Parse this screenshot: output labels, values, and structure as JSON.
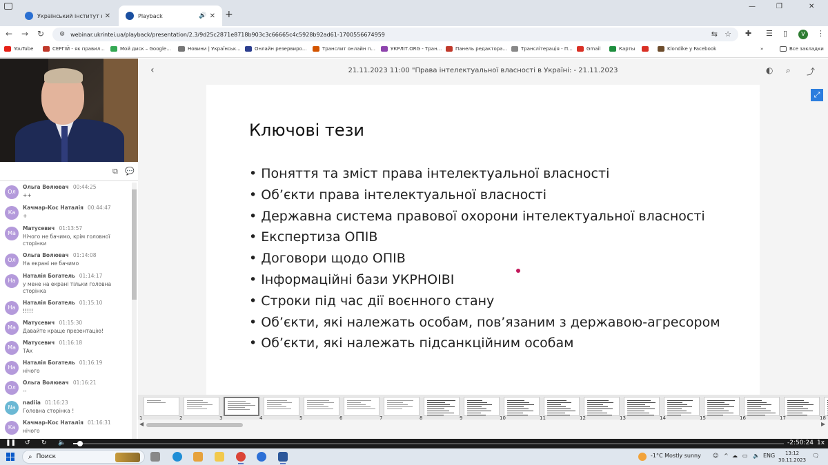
{
  "browser": {
    "tabs": [
      {
        "label": "Український інститут науково",
        "active": false
      },
      {
        "label": "Playback",
        "active": true
      }
    ],
    "url": "webinar.ukrintei.ua/playback/presentation/2.3/9d25c2871e8718b903c3c66665c4c5928b92ad61-1700556674959",
    "avatar_letter": "V",
    "bookmarks": [
      "YouTube",
      "СЕРГІЙ - як правил...",
      "Мой диск – Google...",
      "Новини | Українськ...",
      "Онлайн резервиро...",
      "Транслит онлайн п...",
      "УКРЛІТ.ORG - Тран...",
      "Панель редактора...",
      "Транслітерація - П...",
      "Gmail",
      "Карты",
      "",
      "Klondike у Facebook"
    ],
    "all_bookmarks": "Все закладки"
  },
  "presentation": {
    "title": "21.11.2023 11:00 \"Права інтелектуальної власності в Україні: - 21.11.2023",
    "slide_title": "Ключові тези",
    "bullets": [
      "Поняття та зміст права інтелектуальної власності",
      "Об’єкти права інтелектуальної власності",
      "Державна система правової охорони інтелектуальної власності",
      "Експертиза ОПІВ",
      "Договори щодо ОПІВ",
      "Інформаційні бази УКРНОІВІ",
      "Строки під час дії воєнного стану",
      "Об’єкти, які належать особам, пов’язаним з державою-агресором",
      "Об’єкти, які належать підсанкційним особам"
    ],
    "thumbnails": [
      "1",
      "2",
      "3",
      "4",
      "5",
      "6",
      "7",
      "8",
      "9",
      "10",
      "11",
      "12",
      "13",
      "14",
      "15",
      "16",
      "17",
      "18"
    ],
    "selected_thumbnail": 3
  },
  "chat": {
    "messages": [
      {
        "initials": "Ол",
        "name": "Ольга Волювач",
        "time": "00:44:25",
        "text": "++"
      },
      {
        "initials": "Ка",
        "name": "Качмар-Кос Наталія",
        "time": "00:44:47",
        "text": "+"
      },
      {
        "initials": "Ма",
        "name": "Матусевич",
        "time": "01:13:57",
        "text": "Нічого не бачимо, крім головної сторінки"
      },
      {
        "initials": "Ол",
        "name": "Ольга Волювач",
        "time": "01:14:08",
        "text": "На екрані не бачимо"
      },
      {
        "initials": "На",
        "name": "Наталія Богатель",
        "time": "01:14:17",
        "text": "у мене на екрані тільки головна сторінка"
      },
      {
        "initials": "На",
        "name": "Наталія Богатель",
        "time": "01:15:10",
        "text": "!!!!!"
      },
      {
        "initials": "Ма",
        "name": "Матусевич",
        "time": "01:15:30",
        "text": "Давайте краще презентацію!"
      },
      {
        "initials": "Ма",
        "name": "Матусевич",
        "time": "01:16:18",
        "text": "ТАк"
      },
      {
        "initials": "На",
        "name": "Наталія Богатель",
        "time": "01:16:19",
        "text": "нічого"
      },
      {
        "initials": "Ол",
        "name": "Ольга Волювач",
        "time": "01:16:21",
        "text": "--"
      },
      {
        "initials": "Na",
        "name": "nadiia",
        "time": "01:16:23",
        "text": "Головна сторінка !"
      },
      {
        "initials": "Ка",
        "name": "Качмар-Кос Наталія",
        "time": "01:16:31",
        "text": "нічого"
      }
    ]
  },
  "player": {
    "remaining": "-2:50:24",
    "speed": "1x",
    "progress_fraction": 0.01
  },
  "taskbar": {
    "search_placeholder": "Поиск",
    "weather": "-1°C  Mostly sunny",
    "lang": "ENG",
    "time": "13:12",
    "date": "30.11.2023"
  }
}
